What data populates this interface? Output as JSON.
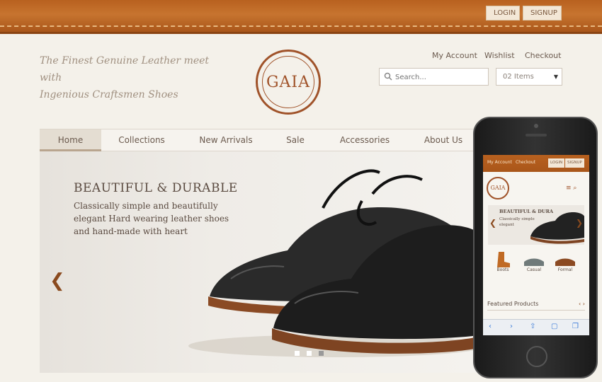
{
  "header": {
    "login_label": "LOGIN",
    "signup_label": "SIGNUP",
    "tagline_line1": "The Finest Genuine Leather meet with",
    "tagline_line2": "Ingenious Craftsmen Shoes",
    "logo_text": "GAIA",
    "links": [
      "My Account",
      "Wishlist",
      "Checkout"
    ],
    "search_placeholder": "Search...",
    "cart_label": "02 Items"
  },
  "nav": {
    "items": [
      "Home",
      "Collections",
      "New Arrivals",
      "Sale",
      "Accessories",
      "About Us"
    ],
    "active": "Home"
  },
  "hero": {
    "title": "BEAUTIFUL & DURABLE",
    "text": "Classically simple and beautifully elegant Hard wearing leather shoes and hand-made with heart",
    "slides_total": 3,
    "slide_active": 1
  },
  "phone": {
    "links": [
      "My Account",
      "Checkout"
    ],
    "login_label": "LOGIN",
    "signup_label": "SIGNUP",
    "logo_text": "GAIA",
    "hero_title": "BEAUTIFUL & DURA",
    "hero_text": "Classically simple elegant",
    "categories": [
      "Boots",
      "Casual",
      "Formal"
    ],
    "featured_label": "Featured Products"
  },
  "colors": {
    "leather": "#b8611f",
    "brand_brown": "#a0532a",
    "background": "#f4f1ea"
  }
}
